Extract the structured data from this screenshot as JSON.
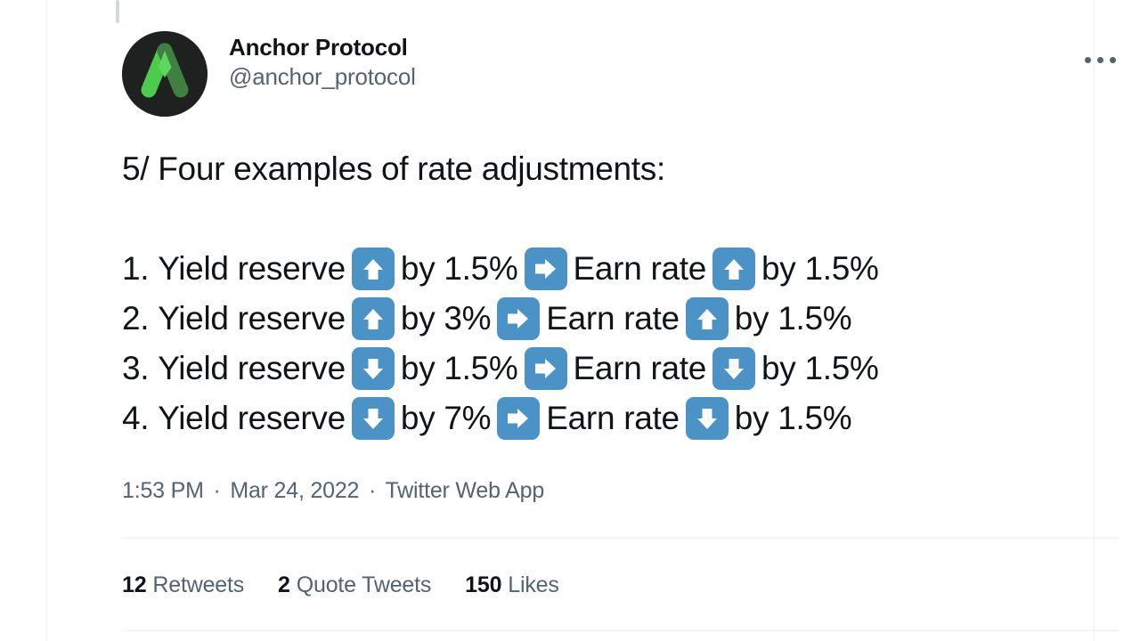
{
  "theme": {
    "background": "#ffffff",
    "text_primary": "#0f1419",
    "text_secondary": "#536471",
    "border": "#eff3f4",
    "thread_line": "#cfd9de",
    "emoji_blue": "#4b92c6",
    "avatar_bg": "#1e2120",
    "logo_green_light": "#4caf50",
    "logo_green_dark": "#3a7a3f"
  },
  "tweet": {
    "author": {
      "display_name": "Anchor Protocol",
      "handle": "@anchor_protocol",
      "avatar_icon": "anchor-protocol-logo"
    },
    "more_button": {
      "icon": "more-horizontal-icon",
      "label": "More"
    },
    "body": {
      "heading": "5/ Four examples of rate adjustments:",
      "items": [
        {
          "index": "1.",
          "subject": "Yield reserve",
          "subject_arrow": "up-arrow-emoji",
          "subject_amount": "by 1.5%",
          "connector_arrow": "right-arrow-emoji",
          "result": "Earn rate",
          "result_arrow": "up-arrow-emoji",
          "result_amount": "by 1.5%",
          "full_text": "1. Yield reserve ⬆ by 1.5% ➡ Earn rate ⬆ by 1.5%"
        },
        {
          "index": "2.",
          "subject": "Yield reserve",
          "subject_arrow": "up-arrow-emoji",
          "subject_amount": "by 3%",
          "connector_arrow": "right-arrow-emoji",
          "result": "Earn rate",
          "result_arrow": "up-arrow-emoji",
          "result_amount": "by 1.5%",
          "full_text": "2. Yield reserve ⬆ by 3% ➡ Earn rate ⬆ by 1.5%"
        },
        {
          "index": "3.",
          "subject": "Yield reserve",
          "subject_arrow": "down-arrow-emoji",
          "subject_amount": "by 1.5%",
          "connector_arrow": "right-arrow-emoji",
          "result": "Earn rate",
          "result_arrow": "down-arrow-emoji",
          "result_amount": "by 1.5%",
          "full_text": "3. Yield reserve ⬇ by 1.5% ➡ Earn rate ⬇ by 1.5%"
        },
        {
          "index": "4.",
          "subject": "Yield reserve",
          "subject_arrow": "down-arrow-emoji",
          "subject_amount": "by 7%",
          "connector_arrow": "right-arrow-emoji",
          "result": "Earn rate",
          "result_arrow": "down-arrow-emoji",
          "result_amount": "by 1.5%",
          "full_text": "4. Yield reserve ⬇ by 7% ➡ Earn rate ⬇ by 1.5%"
        }
      ]
    },
    "meta": {
      "time": "1:53 PM",
      "separator": "·",
      "date": "Mar 24, 2022",
      "source": "Twitter Web App"
    },
    "stats": [
      {
        "count": "12",
        "label": "Retweets"
      },
      {
        "count": "2",
        "label": "Quote Tweets"
      },
      {
        "count": "150",
        "label": "Likes"
      }
    ]
  }
}
